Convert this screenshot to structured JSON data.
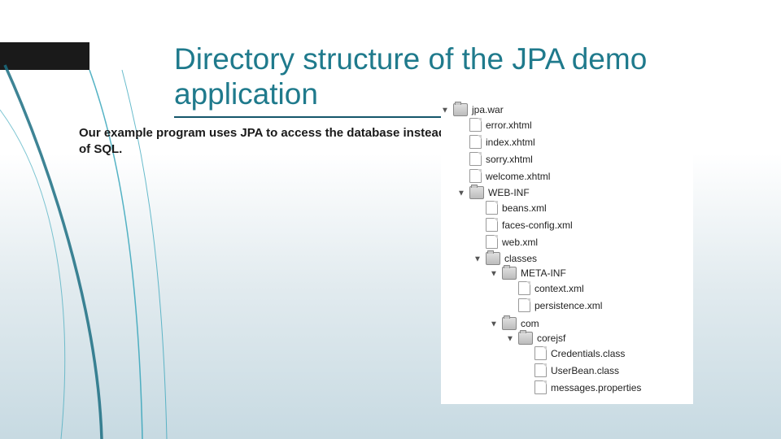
{
  "title": "Directory structure of the JPA demo application",
  "body": "Our example program uses JPA to access the database instead of SQL.",
  "tree": {
    "root": {
      "name": "jpa.war",
      "children": [
        {
          "name": "error.xhtml",
          "kind": "file"
        },
        {
          "name": "index.xhtml",
          "kind": "file"
        },
        {
          "name": "sorry.xhtml",
          "kind": "file"
        },
        {
          "name": "welcome.xhtml",
          "kind": "file"
        },
        {
          "name": "WEB-INF",
          "kind": "folder",
          "children": [
            {
              "name": "beans.xml",
              "kind": "file"
            },
            {
              "name": "faces-config.xml",
              "kind": "file"
            },
            {
              "name": "web.xml",
              "kind": "file"
            },
            {
              "name": "classes",
              "kind": "folder",
              "children": [
                {
                  "name": "META-INF",
                  "kind": "folder",
                  "children": [
                    {
                      "name": "context.xml",
                      "kind": "file"
                    },
                    {
                      "name": "persistence.xml",
                      "kind": "file"
                    }
                  ]
                },
                {
                  "name": "com",
                  "kind": "folder",
                  "children": [
                    {
                      "name": "corejsf",
                      "kind": "folder",
                      "children": [
                        {
                          "name": "Credentials.class",
                          "kind": "file"
                        },
                        {
                          "name": "UserBean.class",
                          "kind": "file"
                        },
                        {
                          "name": "messages.properties",
                          "kind": "file"
                        }
                      ]
                    }
                  ]
                }
              ]
            }
          ]
        }
      ]
    }
  }
}
